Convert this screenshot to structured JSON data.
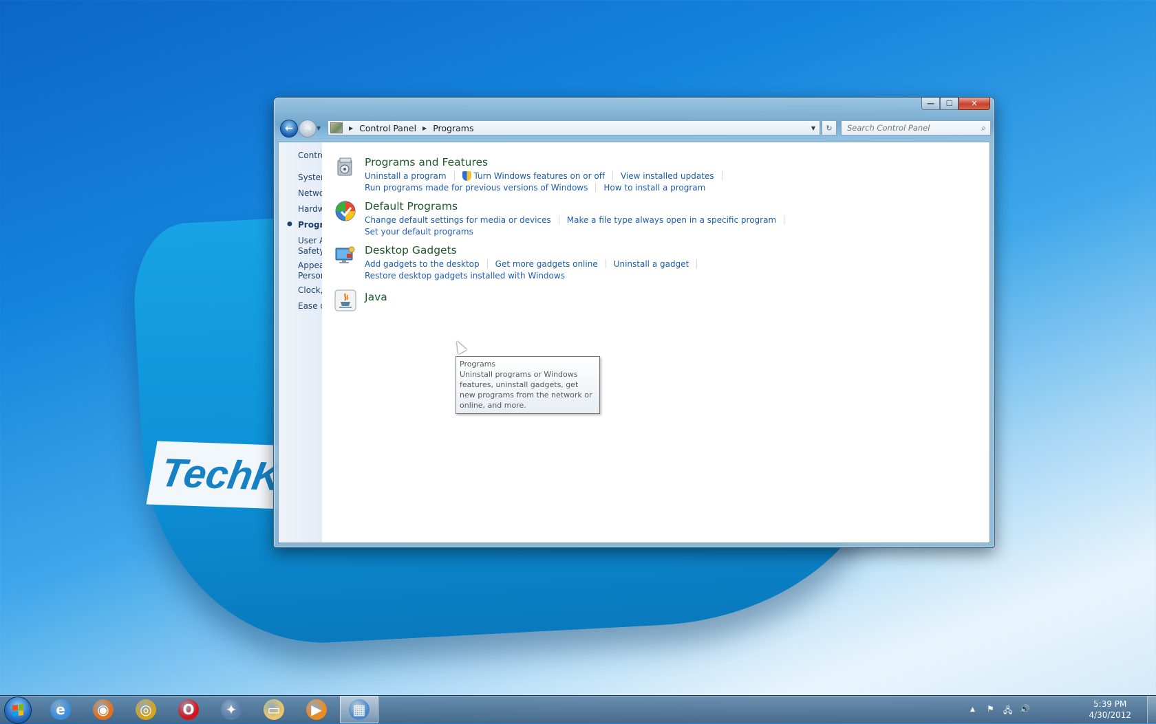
{
  "desktop": {
    "brand_text": "TechK"
  },
  "window": {
    "caption": {
      "minimize": "—",
      "maximize": "☐",
      "close": "✕"
    },
    "nav": {
      "back_glyph": "←",
      "forward_glyph": "→",
      "recent_glyph": "▼"
    },
    "breadcrumb": [
      "Control Panel",
      "Programs"
    ],
    "breadcrumb_sep": "▶",
    "address_dropdown_glyph": "▼",
    "refresh_glyph": "↻",
    "search": {
      "placeholder": "Search Control Panel",
      "value": "",
      "icon_glyph": "⌕"
    },
    "sidebar": {
      "home": "Control Panel Home",
      "items": [
        {
          "label": "System and Security",
          "active": false
        },
        {
          "label": "Network and Internet",
          "active": false
        },
        {
          "label": "Hardware and Sound",
          "active": false
        },
        {
          "label": "Programs",
          "active": true
        },
        {
          "label": "User Accounts and Family Safety",
          "line1": "User Accounts and Family",
          "line2": "Safety",
          "active": false
        },
        {
          "label": "Appearance and Personalization",
          "line1": "Appearance and",
          "line2": "Personalization",
          "active": false
        },
        {
          "label": "Clock, Language, and Region",
          "active": false
        },
        {
          "label": "Ease of Access",
          "active": false
        }
      ],
      "bullet": "●"
    },
    "categories": [
      {
        "title": "Programs and Features",
        "lines": [
          [
            "Uninstall a program",
            "Turn Windows features on or off",
            "View installed updates"
          ],
          [
            "Run programs made for previous versions of Windows",
            "How to install a program"
          ]
        ]
      },
      {
        "title": "Default Programs",
        "lines": [
          [
            "Change default settings for media or devices",
            "Make a file type always open in a specific program"
          ],
          [
            "Set your default programs"
          ]
        ]
      },
      {
        "title": "Desktop Gadgets",
        "lines": [
          [
            "Add gadgets to the desktop",
            "Get more gadgets online",
            "Uninstall a gadget"
          ],
          [
            "Restore desktop gadgets installed with Windows"
          ]
        ]
      },
      {
        "title": "Java",
        "lines": []
      }
    ],
    "tooltip": {
      "title": "Programs",
      "body": "Uninstall programs or Windows features, uninstall gadgets, get new programs from the network or online, and more."
    }
  },
  "taskbar": {
    "apps": [
      {
        "name": "Internet Explorer",
        "glyph": "e",
        "color": "#3a8ee0"
      },
      {
        "name": "Firefox",
        "glyph": "◉",
        "color": "#e2701d"
      },
      {
        "name": "Chrome",
        "glyph": "◎",
        "color": "#d9a21b"
      },
      {
        "name": "Opera",
        "glyph": "O",
        "color": "#d6141a"
      },
      {
        "name": "Safari",
        "glyph": "✦",
        "color": "#5a7ea8"
      },
      {
        "name": "Windows Explorer",
        "glyph": "▭",
        "color": "#e8c76a"
      },
      {
        "name": "Windows Media Player",
        "glyph": "▶",
        "color": "#f08a1c"
      },
      {
        "name": "Control Panel",
        "glyph": "▦",
        "color": "#4b88c8",
        "active": true
      }
    ],
    "tray": {
      "show_hidden": "▲",
      "action_center": "⚑",
      "network": "🖧",
      "volume": "🔊"
    },
    "clock": {
      "time": "5:39 PM",
      "date": "4/30/2012"
    }
  }
}
